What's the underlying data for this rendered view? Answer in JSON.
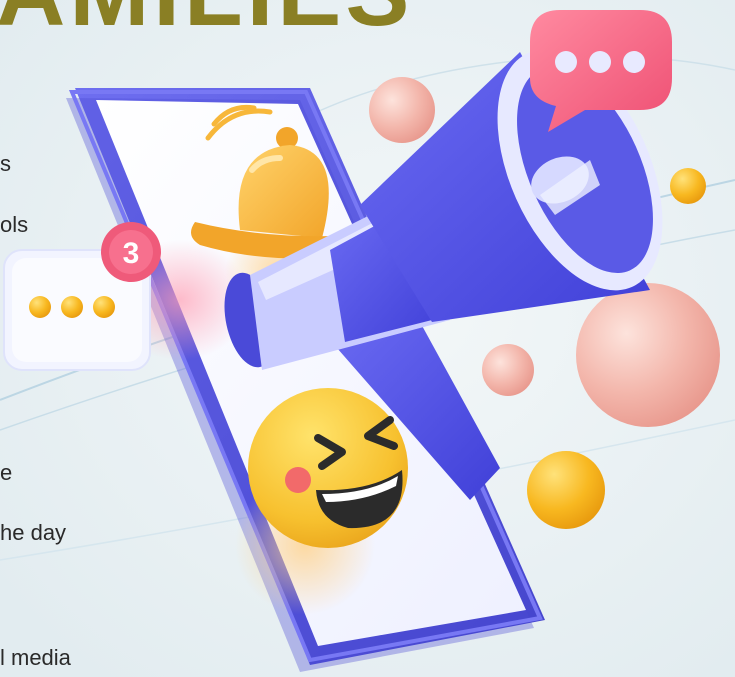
{
  "heading": {
    "text": "AMILIES"
  },
  "text_fragments": [
    "s",
    "ols",
    "e",
    "he day",
    "l media"
  ],
  "notification_badge": {
    "count": "3"
  },
  "colors": {
    "phone_frame": "#5c5ce0",
    "megaphone": "#5050e0",
    "bell": "#f7b73a",
    "emoji": "#f7c12f",
    "badge": "#ef5a7a",
    "speech_bubble": "#f4647f",
    "heading": "#8a7f24"
  },
  "icons": [
    "megaphone-icon",
    "bell-icon",
    "laughing-emoji-icon",
    "speech-bubble-icon",
    "message-card-icon",
    "smartphone-icon"
  ]
}
